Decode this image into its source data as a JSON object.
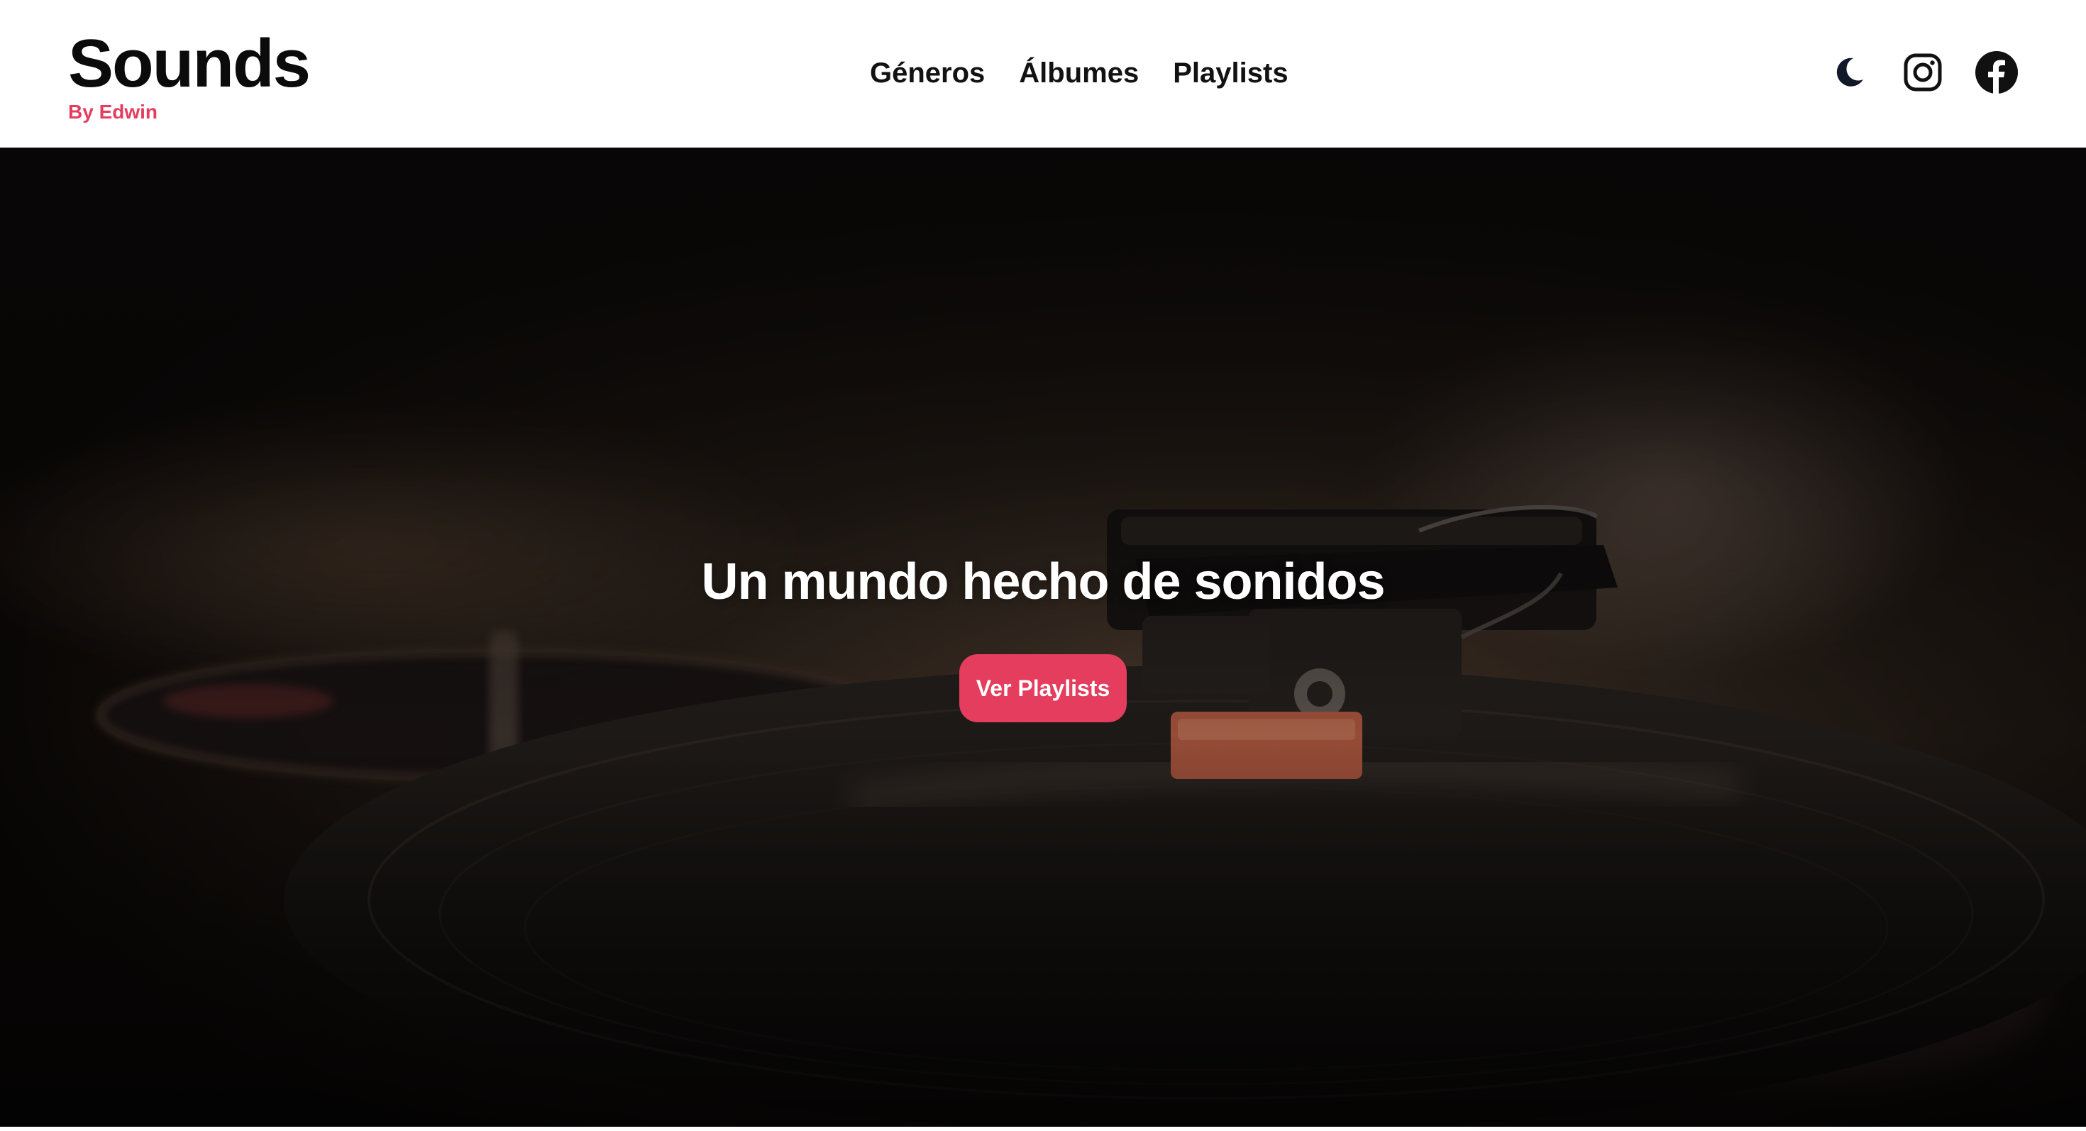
{
  "brand": {
    "title": "Sounds",
    "subtitle": "By Edwin"
  },
  "nav": {
    "items": [
      {
        "label": "Géneros"
      },
      {
        "label": "Álbumes"
      },
      {
        "label": "Playlists"
      }
    ]
  },
  "header_icons": {
    "theme_toggle": "moon-icon",
    "instagram": "instagram-icon",
    "facebook": "facebook-icon"
  },
  "hero": {
    "title": "Un mundo hecho de sonidos",
    "button_label": "Ver Playlists",
    "background": "turntable-photo"
  },
  "colors": {
    "accent": "#e43d5e",
    "text_dark": "#0b0b0b",
    "header_bg": "#ffffff",
    "hero_bg": "#0c0805"
  }
}
